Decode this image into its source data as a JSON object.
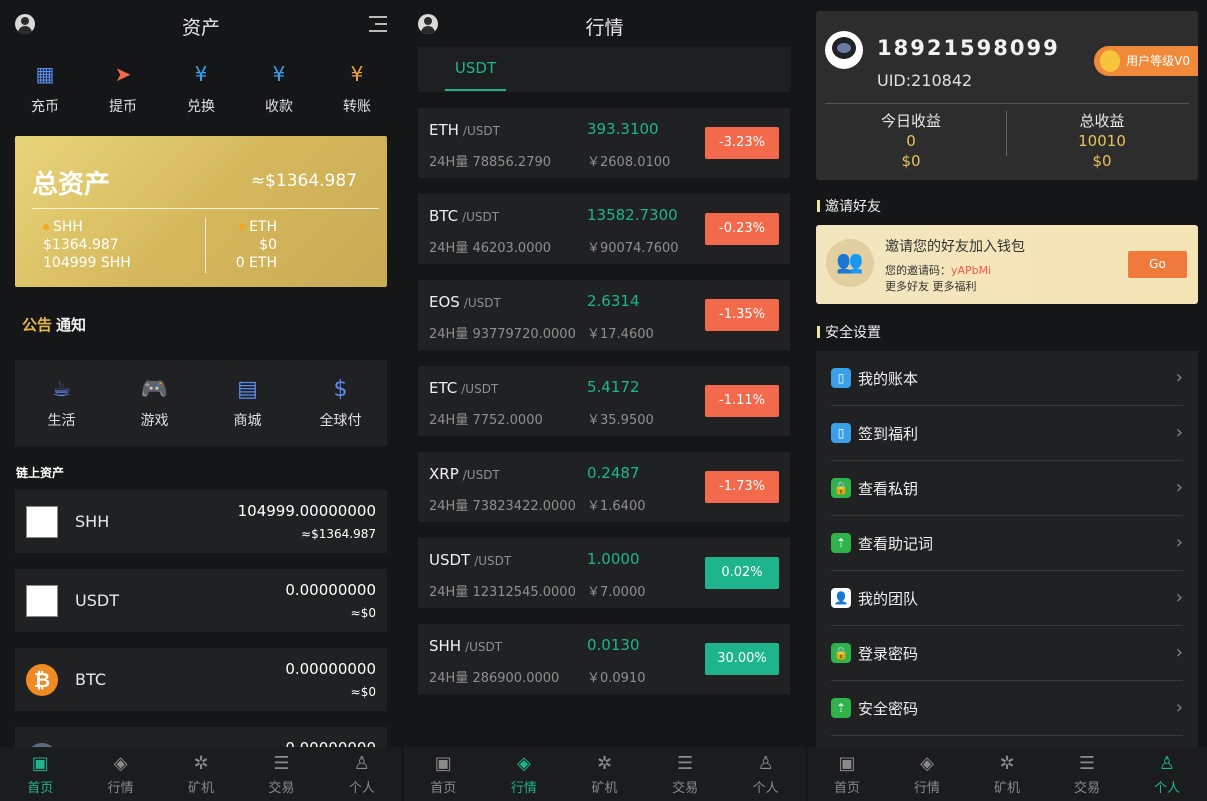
{
  "panel1": {
    "title": "资产",
    "actions": [
      {
        "label": "充币",
        "icon": "qr-code-icon",
        "color": "#5b8cf0"
      },
      {
        "label": "提币",
        "icon": "send-icon",
        "color": "#f2694c"
      },
      {
        "label": "兑换",
        "icon": "exchange-icon",
        "color": "#3aa0e8"
      },
      {
        "label": "收款",
        "icon": "receive-icon",
        "color": "#3aa0e8"
      },
      {
        "label": "转账",
        "icon": "transfer-icon",
        "color": "#f0a040"
      }
    ],
    "total": {
      "label": "总资产",
      "approx": "≈$1364.987",
      "left": {
        "name": "SHH",
        "usd": "$1364.987",
        "amount": "104999 SHH"
      },
      "right": {
        "name": "ETH",
        "usd": "$0",
        "amount": "0 ETH"
      }
    },
    "notice": {
      "highlight": "公告",
      "label": "通知"
    },
    "apps": [
      {
        "label": "生活",
        "icon": "coffee-icon"
      },
      {
        "label": "游戏",
        "icon": "gamepad-icon"
      },
      {
        "label": "商城",
        "icon": "store-icon"
      },
      {
        "label": "全球付",
        "icon": "money-bag-icon"
      }
    ],
    "chain_title": "链上资产",
    "coins": [
      {
        "name": "SHH",
        "amount": "104999.00000000",
        "value": "≈$1364.987"
      },
      {
        "name": "USDT",
        "amount": "0.00000000",
        "value": "≈$0"
      },
      {
        "name": "BTC",
        "amount": "0.00000000",
        "value": "≈$0"
      },
      {
        "name": "",
        "amount": "0.00000000",
        "value": ""
      }
    ],
    "btc_glyph": "₿"
  },
  "panel2": {
    "title": "行情",
    "tab": "USDT",
    "rows": [
      {
        "sym": "ETH",
        "quote": "/USDT",
        "vol": "24H量 78856.2790",
        "price": "393.3100",
        "cny": "￥2608.0100",
        "chg": "-3.23%",
        "dir": "down"
      },
      {
        "sym": "BTC",
        "quote": "/USDT",
        "vol": "24H量 46203.0000",
        "price": "13582.7300",
        "cny": "￥90074.7600",
        "chg": "-0.23%",
        "dir": "down"
      },
      {
        "sym": "EOS",
        "quote": "/USDT",
        "vol": "24H量 93779720.0000",
        "price": "2.6314",
        "cny": "￥17.4600",
        "chg": "-1.35%",
        "dir": "down"
      },
      {
        "sym": "ETC",
        "quote": "/USDT",
        "vol": "24H量 7752.0000",
        "price": "5.4172",
        "cny": "￥35.9500",
        "chg": "-1.11%",
        "dir": "down"
      },
      {
        "sym": "XRP",
        "quote": "/USDT",
        "vol": "24H量 73823422.0000",
        "price": "0.2487",
        "cny": "￥1.6400",
        "chg": "-1.73%",
        "dir": "down"
      },
      {
        "sym": "USDT",
        "quote": "/USDT",
        "vol": "24H量 12312545.0000",
        "price": "1.0000",
        "cny": "￥7.0000",
        "chg": "0.02%",
        "dir": "up"
      },
      {
        "sym": "SHH",
        "quote": "/USDT",
        "vol": "24H量 286900.0000",
        "price": "0.0130",
        "cny": "￥0.0910",
        "chg": "30.00%",
        "dir": "up"
      }
    ]
  },
  "panel3": {
    "phone": "18921598099",
    "uid": "UID:210842",
    "level": "用户等级V0",
    "today": {
      "label": "今日收益",
      "value": "0",
      "usd": "$0"
    },
    "total": {
      "label": "总收益",
      "value": "10010",
      "usd": "$0"
    },
    "invite_title": "邀请好友",
    "invite": {
      "headline": "邀请您的好友加入钱包",
      "code_label": "您的邀请码：",
      "code": "yAPbMi",
      "more": "更多好友 更多福利",
      "go": "Go"
    },
    "security_title": "安全设置",
    "settings": [
      {
        "label": "我的账本",
        "icon": "phone-icon",
        "color": "#3aa0e8"
      },
      {
        "label": "签到福利",
        "icon": "phone-icon",
        "color": "#3aa0e8"
      },
      {
        "label": "查看私钥",
        "icon": "lock-icon",
        "color": "#2fb34a"
      },
      {
        "label": "查看助记词",
        "icon": "upload-icon",
        "color": "#2fb34a"
      },
      {
        "label": "我的团队",
        "icon": "team-icon",
        "color": "#ffffff"
      },
      {
        "label": "登录密码",
        "icon": "lock-icon",
        "color": "#2fb34a"
      },
      {
        "label": "安全密码",
        "icon": "upload-icon",
        "color": "#2fb34a"
      }
    ]
  },
  "tabs": [
    {
      "label": "首页",
      "icon": "wallet-icon"
    },
    {
      "label": "行情",
      "icon": "market-icon"
    },
    {
      "label": "矿机",
      "icon": "miner-icon"
    },
    {
      "label": "交易",
      "icon": "trade-icon"
    },
    {
      "label": "个人",
      "icon": "person-icon"
    }
  ],
  "glyphs": {
    "qr-code-icon": "▦",
    "send-icon": "➤",
    "exchange-icon": "¥",
    "receive-icon": "¥",
    "transfer-icon": "¥",
    "coffee-icon": "☕",
    "gamepad-icon": "🎮",
    "store-icon": "▤",
    "money-bag-icon": "$",
    "wallet-icon": "▣",
    "market-icon": "◈",
    "miner-icon": "✲",
    "trade-icon": "☰",
    "person-icon": "♙",
    "phone-icon": "▯",
    "lock-icon": "🔒",
    "upload-icon": "⇡",
    "team-icon": "👤",
    "users-icon": "👥",
    "chevron-right-icon": "›"
  },
  "colors": {
    "accent": "#1fb58c",
    "down": "#f2694c",
    "up": "#1fb58c",
    "gold": "#e8c35a"
  }
}
